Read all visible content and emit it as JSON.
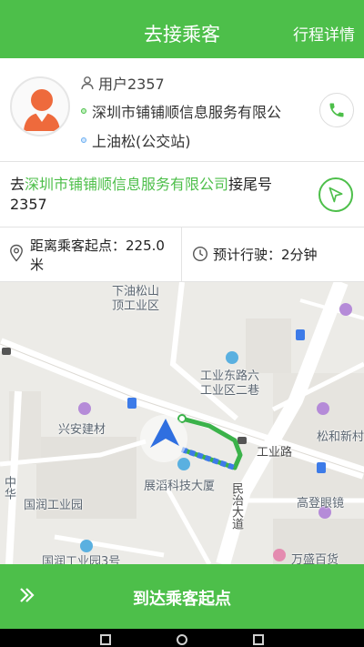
{
  "header": {
    "title": "去接乘客",
    "action_label": "行程详情"
  },
  "passenger": {
    "user_label": "用户2357",
    "pickup": "深圳市铺铺顺信息服务有限公",
    "dropoff": "上油松(公交站)"
  },
  "destination": {
    "prefix": "去",
    "place": "深圳市铺铺顺信息服务有限公司",
    "suffix": "接尾号2357"
  },
  "info": {
    "distance_text": "距离乘客起点：225.0米",
    "eta_text": "预计行驶：2分钟"
  },
  "map": {
    "labels": [
      "下油松山",
      "顶工业区",
      "工业东路六",
      "工业区二巷",
      "兴安建材",
      "工业路",
      "松和新村",
      "展滔科技大厦",
      "民治大道",
      "国润工业园",
      "高登眼镜",
      "国润工业园3号",
      "万盛百货",
      "中华"
    ]
  },
  "bottom": {
    "action_label": "到达乘客起点"
  },
  "colors": {
    "brand_green": "#4dbf4a",
    "route_blue": "#3d7be8"
  },
  "icons": [
    "person-icon",
    "phone-icon",
    "navigate-icon",
    "location-pin-icon",
    "clock-icon",
    "chevron-right-double-icon",
    "car-arrow-icon"
  ]
}
